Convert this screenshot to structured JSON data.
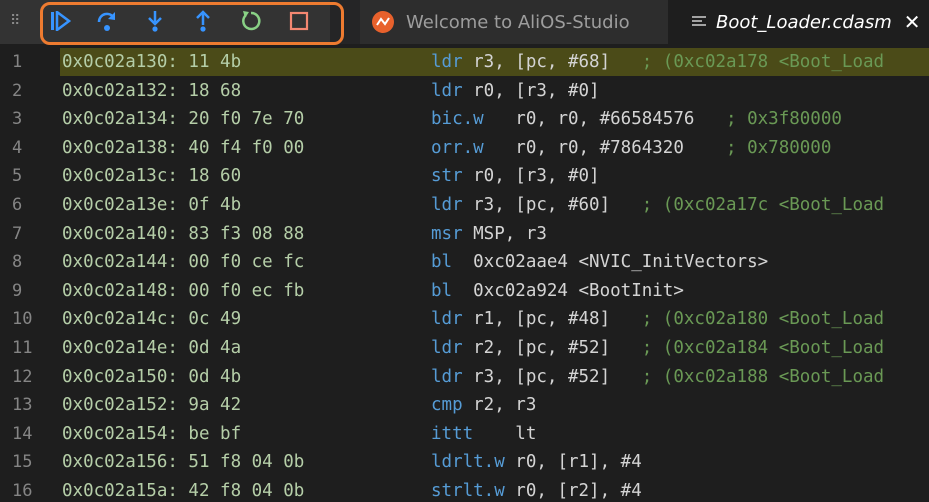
{
  "toolbar": {
    "drag_handle_glyph": "⠿",
    "buttons": [
      {
        "name": "continue-icon",
        "color": "#3794ff"
      },
      {
        "name": "step-over-icon",
        "color": "#3794ff"
      },
      {
        "name": "step-into-icon",
        "color": "#3794ff"
      },
      {
        "name": "step-out-icon",
        "color": "#3794ff"
      },
      {
        "name": "restart-icon",
        "color": "#89d185"
      },
      {
        "name": "stop-icon",
        "color": "#f48771"
      }
    ],
    "highlight_color": "#ee7b30"
  },
  "tabs": [
    {
      "label": "Welcome to AliOS-Studio",
      "icon": "alios-logo-icon",
      "active": false
    },
    {
      "label": "Boot_Loader.cdasm",
      "icon": "file-lines-icon",
      "active": true,
      "close_glyph": "✕"
    }
  ],
  "editor": {
    "current_line": 1,
    "lines": [
      {
        "num": "1",
        "addr": "0x0c02a130: 11 4b",
        "mnemonic": "ldr",
        "operands": " r3, [pc, #68]",
        "comment": "   ; (0xc02a178 <Boot_Load"
      },
      {
        "num": "2",
        "addr": "0x0c02a132: 18 68",
        "mnemonic": "ldr",
        "operands": " r0, [r3, #0]",
        "comment": ""
      },
      {
        "num": "3",
        "addr": "0x0c02a134: 20 f0 7e 70",
        "mnemonic": "bic.w",
        "operands": "   r0, r0, #66584576",
        "comment": "   ; 0x3f80000"
      },
      {
        "num": "4",
        "addr": "0x0c02a138: 40 f4 f0 00",
        "mnemonic": "orr.w",
        "operands": "   r0, r0, #7864320",
        "comment": "    ; 0x780000"
      },
      {
        "num": "5",
        "addr": "0x0c02a13c: 18 60",
        "mnemonic": "str",
        "operands": " r0, [r3, #0]",
        "comment": ""
      },
      {
        "num": "6",
        "addr": "0x0c02a13e: 0f 4b",
        "mnemonic": "ldr",
        "operands": " r3, [pc, #60]",
        "comment": "   ; (0xc02a17c <Boot_Load"
      },
      {
        "num": "7",
        "addr": "0x0c02a140: 83 f3 08 88",
        "mnemonic": "msr",
        "operands": " MSP, r3",
        "comment": ""
      },
      {
        "num": "8",
        "addr": "0x0c02a144: 00 f0 ce fc",
        "mnemonic": "bl",
        "operands": "  0xc02aae4 <NVIC_InitVectors>",
        "comment": ""
      },
      {
        "num": "9",
        "addr": "0x0c02a148: 00 f0 ec fb",
        "mnemonic": "bl",
        "operands": "  0xc02a924 <BootInit>",
        "comment": ""
      },
      {
        "num": "10",
        "addr": "0x0c02a14c: 0c 49",
        "mnemonic": "ldr",
        "operands": " r1, [pc, #48]",
        "comment": "   ; (0xc02a180 <Boot_Load"
      },
      {
        "num": "11",
        "addr": "0x0c02a14e: 0d 4a",
        "mnemonic": "ldr",
        "operands": " r2, [pc, #52]",
        "comment": "   ; (0xc02a184 <Boot_Load"
      },
      {
        "num": "12",
        "addr": "0x0c02a150: 0d 4b",
        "mnemonic": "ldr",
        "operands": " r3, [pc, #52]",
        "comment": "   ; (0xc02a188 <Boot_Load"
      },
      {
        "num": "13",
        "addr": "0x0c02a152: 9a 42",
        "mnemonic": "cmp",
        "operands": " r2, r3",
        "comment": ""
      },
      {
        "num": "14",
        "addr": "0x0c02a154: be bf",
        "mnemonic": "ittt",
        "operands": "    lt",
        "comment": ""
      },
      {
        "num": "15",
        "addr": "0x0c02a156: 51 f8 04 0b",
        "mnemonic": "ldrlt.w",
        "operands": " r0, [r1], #4",
        "comment": ""
      },
      {
        "num": "16",
        "addr": "0x0c02a15a: 42 f8 04 0b",
        "mnemonic": "strlt.w",
        "operands": " r0, [r2], #4",
        "comment": ""
      }
    ]
  }
}
